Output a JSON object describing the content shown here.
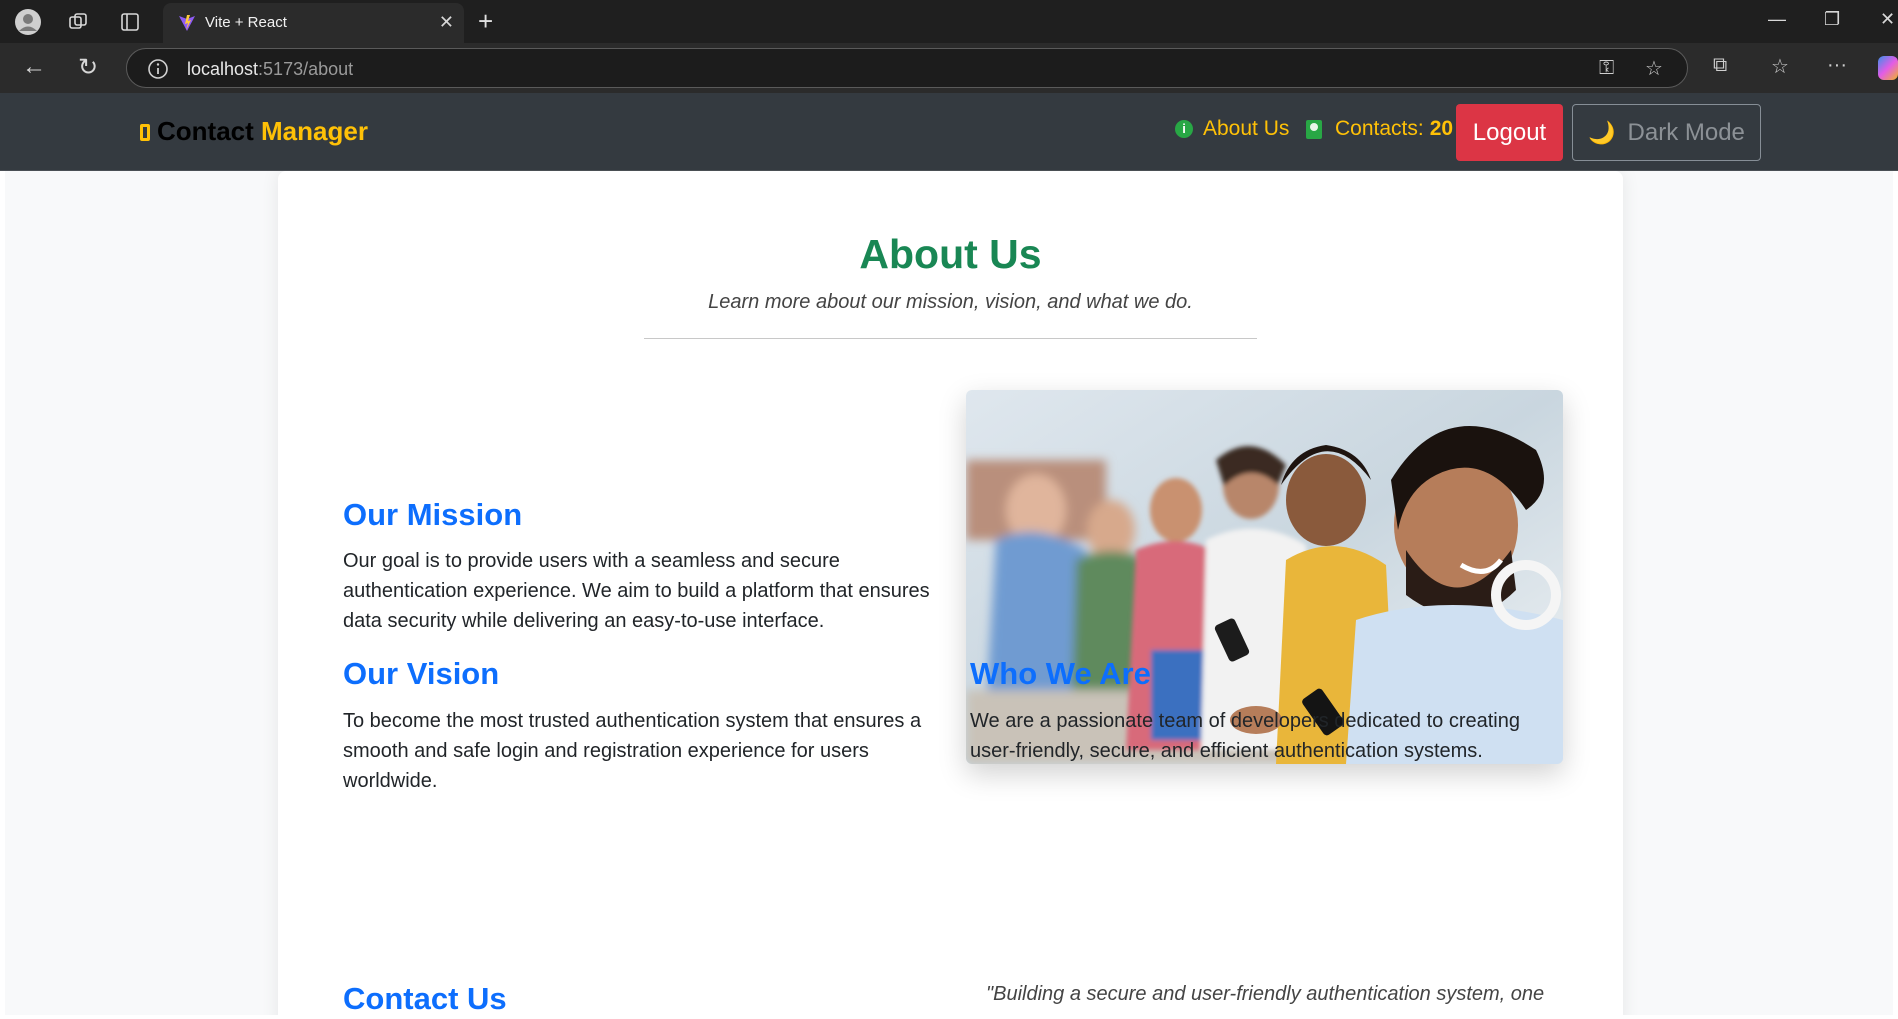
{
  "browser": {
    "tab_title": "Vite + React",
    "url_host": "localhost",
    "url_path": ":5173/about"
  },
  "navbar": {
    "brand_part1": "Contact",
    "brand_part2": "Manager",
    "about_label": "About Us",
    "contacts_label": "Contacts:",
    "contacts_count": "20",
    "logout_label": "Logout",
    "dark_mode_label": "Dark Mode"
  },
  "about": {
    "title": "About Us",
    "subtitle": "Learn more about our mission, vision, and what we do.",
    "mission_title": "Our Mission",
    "mission_text": "Our goal is to provide users with a seamless and secure authentication experience. We aim to build a platform that ensures data security while delivering an easy-to-use interface.",
    "vision_title": "Our Vision",
    "vision_text": "To become the most trusted authentication system that ensures a smooth and safe login and registration experience for users worldwide.",
    "who_title": "Who We Are",
    "who_text": "We are a passionate team of developers dedicated to creating user-friendly, secure, and efficient authentication systems.",
    "contact_title": "Contact Us",
    "quote": "\"Building a secure and user-friendly authentication system, one"
  },
  "colors": {
    "navbar_bg": "#343a40",
    "accent_yellow": "#ffc107",
    "heading_green": "#198754",
    "section_blue": "#0d6efd",
    "logout_red": "#dc3545"
  },
  "icons": {
    "brand": "phone-icon",
    "about": "info-circle-icon",
    "contacts": "contact-card-icon",
    "dark_mode": "moon-icon",
    "image": "team-photo"
  }
}
